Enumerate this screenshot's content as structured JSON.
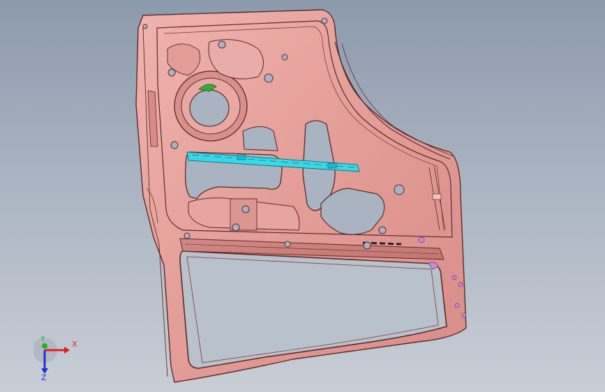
{
  "viewport": {
    "background_top": "#8c9aad",
    "background_bottom": "#c9ced6"
  },
  "model": {
    "part": "car-door-inner-panel",
    "body_color": "#e7a4a1",
    "edge_color": "#5a2a28",
    "highlight_cyan": "#39d8e8",
    "highlight_green": "#39a83a",
    "highlight_magenta": "#c88ad8"
  },
  "triad": {
    "x_label": "X",
    "y_label": "Y",
    "z_label": "Z",
    "x_color": "#e02020",
    "y_color": "#20b020",
    "z_color": "#2030d0"
  }
}
